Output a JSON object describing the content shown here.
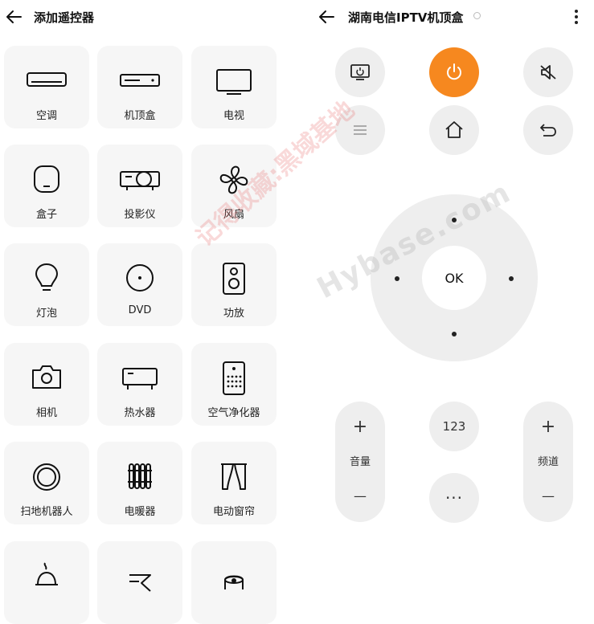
{
  "left": {
    "title": "添加遥控器",
    "devices": [
      {
        "label": "空调",
        "icon": "air-conditioner-icon"
      },
      {
        "label": "机顶盒",
        "icon": "set-top-box-icon"
      },
      {
        "label": "电视",
        "icon": "tv-icon"
      },
      {
        "label": "盒子",
        "icon": "box-icon"
      },
      {
        "label": "投影仪",
        "icon": "projector-icon"
      },
      {
        "label": "风扇",
        "icon": "fan-icon"
      },
      {
        "label": "灯泡",
        "icon": "bulb-icon"
      },
      {
        "label": "DVD",
        "icon": "dvd-icon"
      },
      {
        "label": "功放",
        "icon": "amplifier-icon"
      },
      {
        "label": "相机",
        "icon": "camera-icon"
      },
      {
        "label": "热水器",
        "icon": "water-heater-icon"
      },
      {
        "label": "空气净化器",
        "icon": "air-purifier-icon"
      },
      {
        "label": "扫地机器人",
        "icon": "robot-vacuum-icon"
      },
      {
        "label": "电暖器",
        "icon": "heater-icon"
      },
      {
        "label": "电动窗帘",
        "icon": "curtain-icon"
      },
      {
        "label": "",
        "icon": "rice-cooker-icon"
      },
      {
        "label": "",
        "icon": "hourglass-icon"
      },
      {
        "label": "",
        "icon": "roll-icon"
      }
    ]
  },
  "right": {
    "title": "湖南电信IPTV机顶盒",
    "ok_label": "OK",
    "num_label": "123",
    "more_label": "···",
    "volume": {
      "plus": "+",
      "label": "音量",
      "minus": "—"
    },
    "channel": {
      "plus": "+",
      "label": "频道",
      "minus": "—"
    }
  },
  "watermark": {
    "text_a": "记得收藏:黑域基地",
    "text_b": "Hybase.com"
  },
  "colors": {
    "accent": "#f6881f",
    "tile_bg": "#f6f6f6",
    "button_bg": "#eeeeee"
  }
}
